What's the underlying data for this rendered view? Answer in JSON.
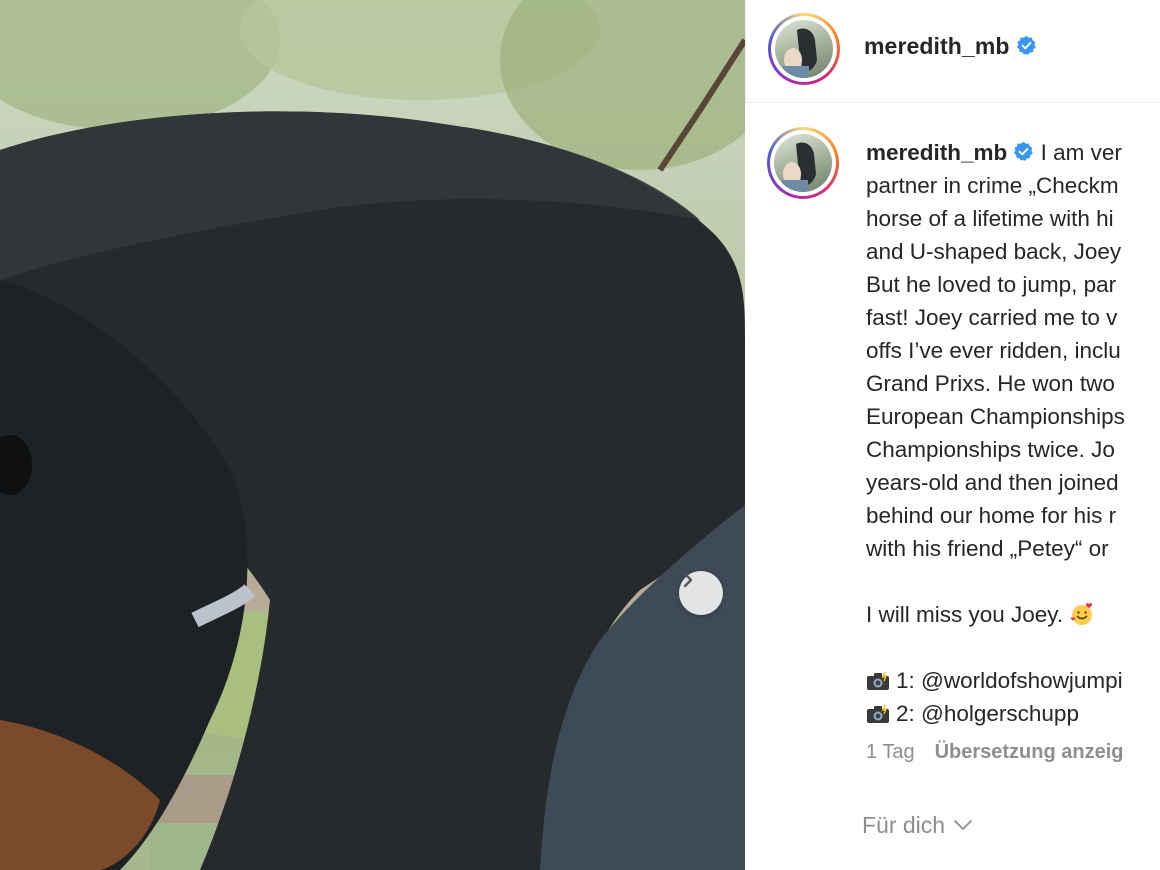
{
  "post": {
    "username": "meredith_mb",
    "verified": true,
    "photo_alt": "horse-photo",
    "caption_lines": [
      "I am ver",
      "partner in crime „Checkm",
      "horse of a lifetime with hi",
      "and U-shaped back, Joey",
      "But he loved to jump, par",
      "fast! Joey carried me to v",
      "offs I’ve ever ridden, inclu",
      "Grand Prixs. He won two",
      "European Championships",
      "Championships twice. Jo",
      "years-old and then joined",
      "behind our home for his r",
      "with his friend „Petey“ or"
    ],
    "farewell": "I will miss you Joey.",
    "credits": [
      {
        "text": "1: @worldofshowjumpi"
      },
      {
        "text": "2: @holgerschupp"
      }
    ],
    "timestamp": "1 Tag",
    "translate_label": "Übersetzung anzeig",
    "for_you_label": "Für dich"
  },
  "colors": {
    "text": "#262626",
    "muted": "#8e8e8e",
    "verified_blue": "#3897f0"
  },
  "icons": [
    "verified-badge-icon",
    "camera-flash-icon",
    "smiling-face-hearts-icon",
    "chevron-right-icon",
    "chevron-down-icon"
  ]
}
